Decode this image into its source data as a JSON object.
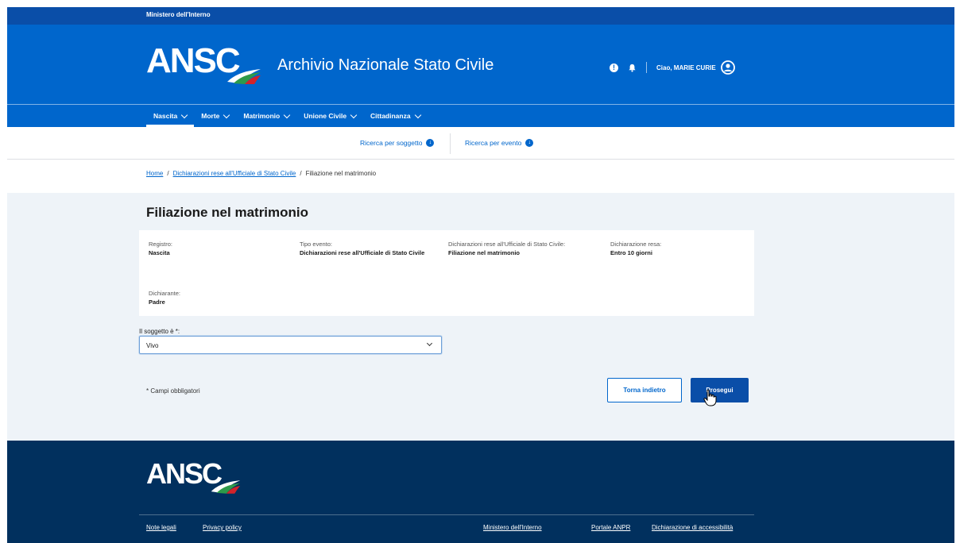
{
  "top_bar": {
    "org": "Ministero dell'Interno"
  },
  "header": {
    "logo_text": "ANSC",
    "title": "Archivio Nazionale Stato Civile",
    "greeting": "Ciao, MARIE CURIE",
    "icons": [
      "info-icon",
      "bell-icon",
      "user-avatar-icon"
    ]
  },
  "nav": {
    "items": [
      {
        "label": "Nascita",
        "active": true
      },
      {
        "label": "Morte"
      },
      {
        "label": "Matrimonio"
      },
      {
        "label": "Unione Civile"
      },
      {
        "label": "Cittadinanza"
      }
    ]
  },
  "subnav": {
    "search_subject": "Ricerca per soggetto",
    "search_event": "Ricerca per evento"
  },
  "breadcrumb": {
    "home": "Home",
    "parent": "Dichiarazioni rese all'Ufficiale di Stato Civile",
    "current": "Filiazione nel matrimonio",
    "separator": "/"
  },
  "main": {
    "title": "Filiazione nel matrimonio",
    "summary": {
      "registro": {
        "label": "Registro:",
        "value": "Nascita"
      },
      "tipo_evento": {
        "label": "Tipo evento:",
        "value": "Dichiarazioni rese all'Ufficiale di Stato Civile"
      },
      "dichiarazioni": {
        "label": "Dichiarazioni rese all'Ufficiale di Stato Civile:",
        "value": "Filiazione nel matrimonio"
      },
      "dichiarazione_resa": {
        "label": "Dichiarazione resa:",
        "value": "Entro 10 giorni"
      },
      "dichiarante": {
        "label": "Dichiarante:",
        "value": "Padre"
      }
    },
    "question_label": "Il soggetto è *:",
    "select_value": "Vivo",
    "required_note": "* Campi obbligatori",
    "back_button": "Torna indietro",
    "next_button": "Prosegui"
  },
  "footer": {
    "logo_text": "ANSC",
    "links": {
      "legal": "Note legali",
      "privacy": "Privacy policy",
      "ministry": "Ministero dell'Interno",
      "anpr": "Portale ANPR",
      "accessibility": "Dichiarazione di accessibilità"
    }
  },
  "colors": {
    "primary": "#0066cc",
    "dark_blue": "#0a4ea8",
    "footer": "#01305e",
    "main_bg": "#eef3f8"
  }
}
